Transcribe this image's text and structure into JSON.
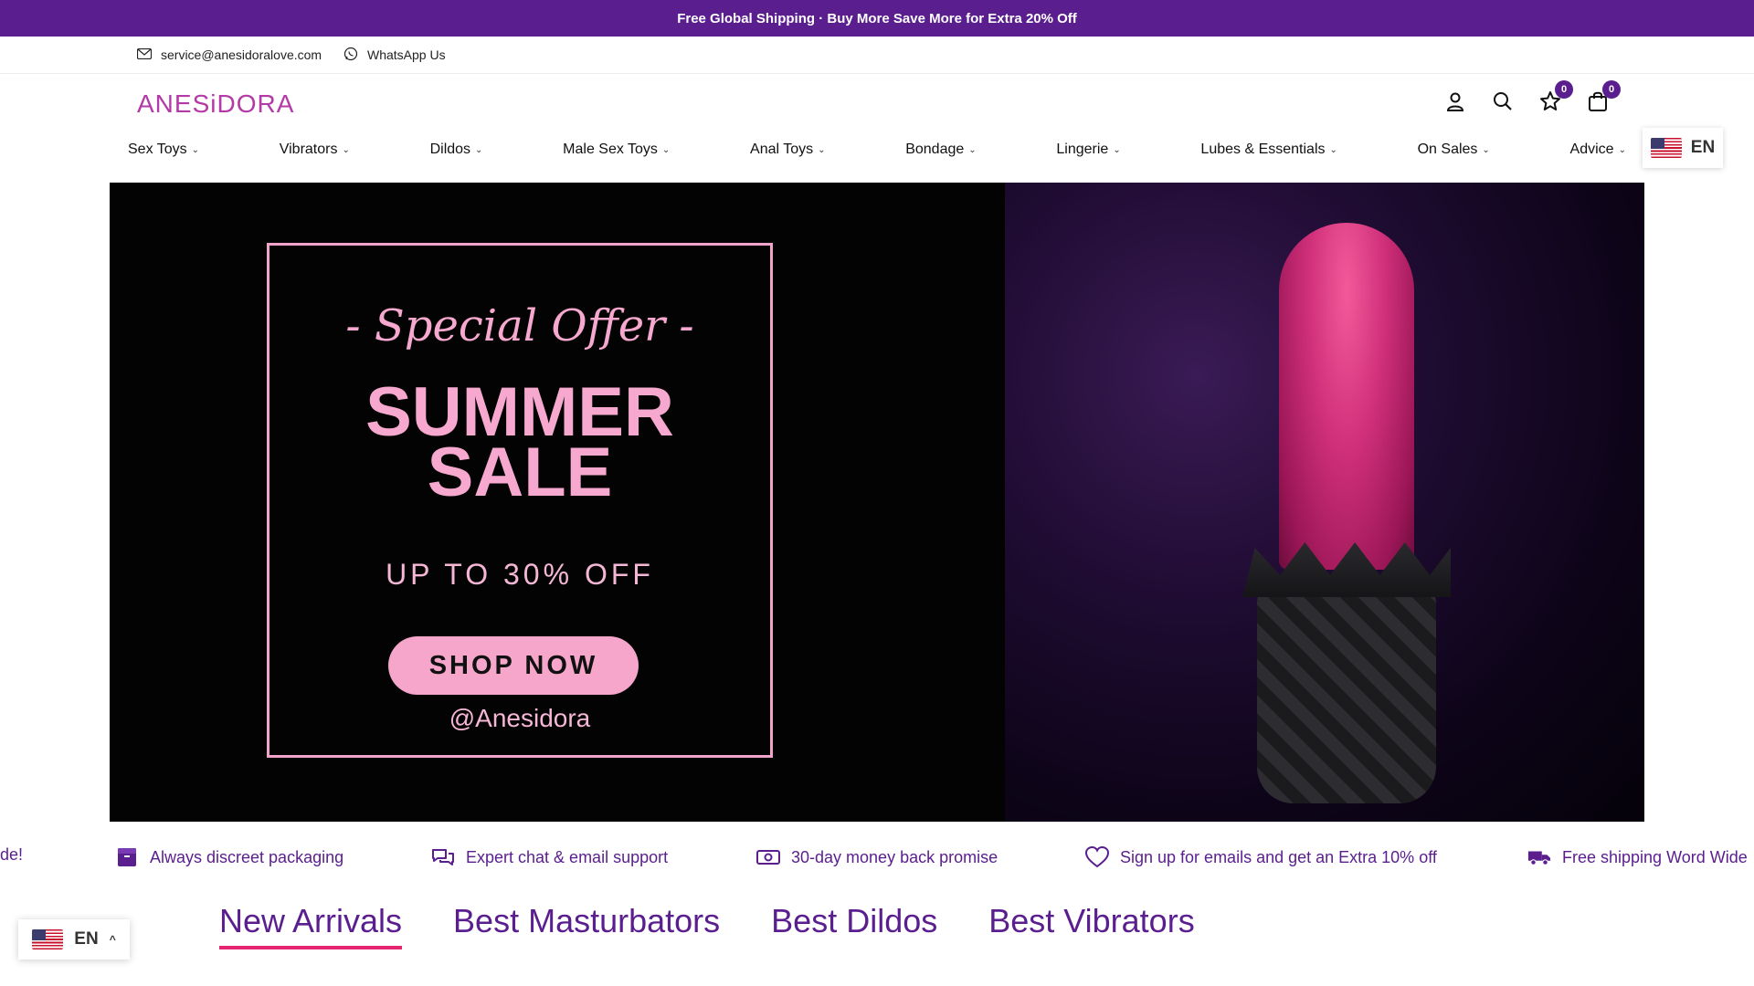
{
  "announcement": "Free Global Shipping · Buy More Save More for Extra 20% Off",
  "contact": {
    "email": "service@anesidoralove.com",
    "whatsapp": "WhatsApp Us"
  },
  "brand": {
    "logo": "ANESiDORA"
  },
  "header": {
    "wishlist_count": "0",
    "cart_count": "0"
  },
  "nav": [
    {
      "label": "Sex Toys"
    },
    {
      "label": "Vibrators"
    },
    {
      "label": "Dildos"
    },
    {
      "label": "Male Sex Toys"
    },
    {
      "label": "Anal Toys"
    },
    {
      "label": "Bondage"
    },
    {
      "label": "Lingerie"
    },
    {
      "label": "Lubes & Essentials"
    },
    {
      "label": "On Sales"
    },
    {
      "label": "Advice"
    }
  ],
  "language": {
    "code": "EN"
  },
  "hero": {
    "special_offer": "- Special Offer -",
    "headline_line1": "SUMMER",
    "headline_line2": "SALE",
    "subheadline": "UP TO 30% OFF",
    "cta": "SHOP NOW",
    "handle": "@Anesidora"
  },
  "benefits": [
    {
      "label": "de!"
    },
    {
      "label": "Always discreet packaging",
      "icon": "box-icon"
    },
    {
      "label": "Expert chat & email support",
      "icon": "chat-icon"
    },
    {
      "label": "30-day money back promise",
      "icon": "money-icon"
    },
    {
      "label": "Sign up for emails and get an Extra 10% off",
      "icon": "heart-icon"
    },
    {
      "label": "Free shipping Word Wide",
      "icon": "truck-icon"
    }
  ],
  "tabs": [
    {
      "label": "New Arrivals",
      "active": true
    },
    {
      "label": "Best Masturbators"
    },
    {
      "label": "Best Dildos"
    },
    {
      "label": "Best Vibrators"
    }
  ],
  "colors": {
    "brand_purple": "#5a1e8f",
    "accent_pink": "#f6a5cb",
    "tab_underline": "#e5256f"
  }
}
